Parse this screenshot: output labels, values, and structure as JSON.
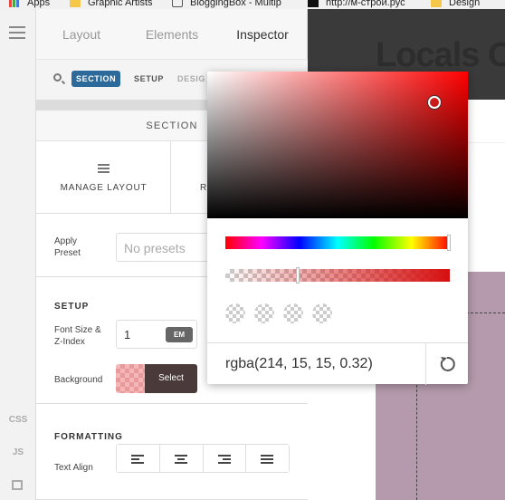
{
  "bookmarks": [
    {
      "label": "Apps",
      "icon": "apps-icon"
    },
    {
      "label": "Graphic Artists",
      "icon": "folder-icon"
    },
    {
      "label": "BloggingBox - Multip",
      "icon": "cart-icon"
    },
    {
      "label": "http://м-строй.рус",
      "icon": "site-icon"
    },
    {
      "label": "Design",
      "icon": "folder-icon"
    }
  ],
  "rail": {
    "css": "CSS",
    "js": "JS"
  },
  "tabs": [
    "Layout",
    "Elements",
    "Inspector"
  ],
  "breadcrumbs": {
    "current": "SECTION",
    "next": "SETUP",
    "more": "DESIG"
  },
  "section_head": "SECTION",
  "actions": {
    "manage": "MANAGE LAYOUT",
    "right": "R"
  },
  "preset": {
    "label_line1": "Apply",
    "label_line2": "Preset",
    "placeholder": "No presets"
  },
  "setup": {
    "heading": "SETUP",
    "font_label_line1": "Font Size &",
    "font_label_line2": "Z-Index",
    "font_value": "1",
    "unit": "EM",
    "bg_label": "Background",
    "select": "Select"
  },
  "formatting": {
    "heading": "FORMATTING",
    "align_label": "Text Align"
  },
  "preview": {
    "title": "Locals O"
  },
  "picker": {
    "value": "rgba(214, 15, 15, 0.32)",
    "hue_color": "#ff0000",
    "alpha": 0.32
  }
}
